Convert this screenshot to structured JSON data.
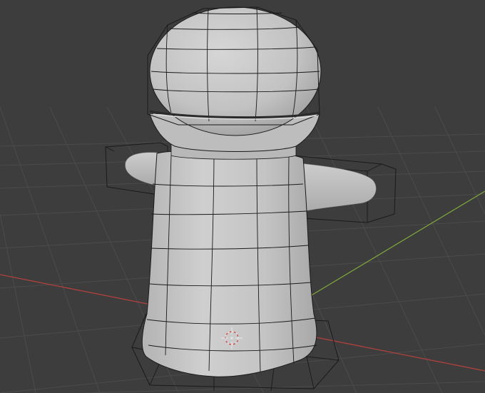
{
  "app": {
    "view": "3D Viewport"
  },
  "viewport": {
    "background_color": "#3d3d3d",
    "grid_color": "#4a4a4a",
    "x_axis_color": "#b0413e",
    "y_axis_color": "#7ea33b",
    "object": {
      "kind": "mesh",
      "shading": "solid",
      "wireframe_overlay": true,
      "surface_color": "#c5c5c5",
      "wire_color": "#1a1a1a"
    },
    "cursor_3d": {
      "visible": true,
      "icon": "3d-cursor-icon"
    }
  }
}
